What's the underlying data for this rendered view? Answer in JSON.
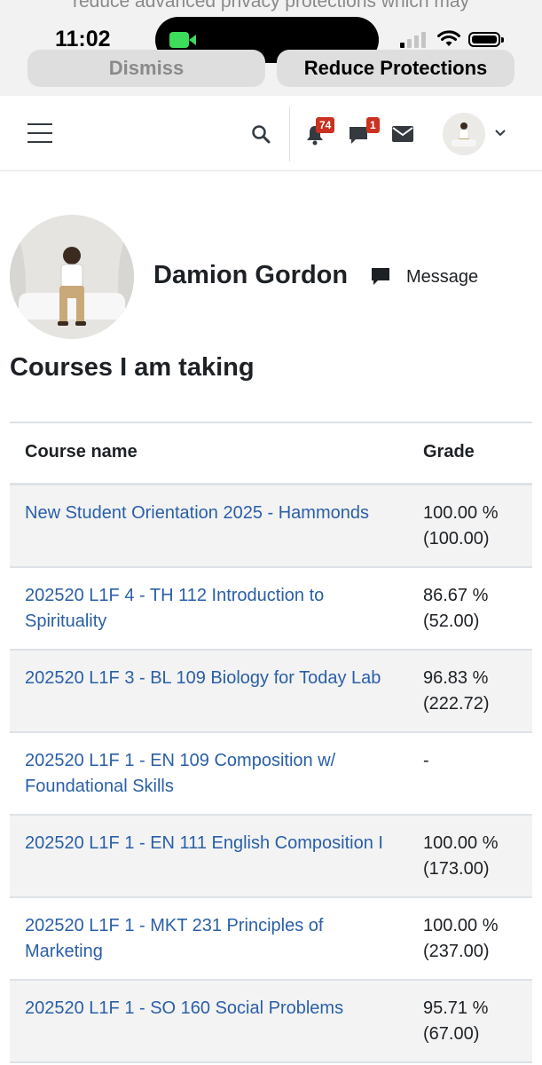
{
  "ios_banner": {
    "message": "reduce advanced privacy protections which may",
    "time": "11:02",
    "dismiss_label": "Dismiss",
    "reduce_label": "Reduce Protections"
  },
  "navbar": {
    "notification_count": "74",
    "message_count": "1",
    "icons": [
      "hamburger-icon",
      "search-icon",
      "bell-icon",
      "chat-icon",
      "mail-icon",
      "chevron-down-icon"
    ]
  },
  "profile": {
    "name": "Damion Gordon",
    "message_label": "Message"
  },
  "courses": {
    "title": "Courses I am taking",
    "columns": [
      "Course name",
      "Grade"
    ],
    "rows": [
      {
        "name": "New Student Orientation 2025 - Hammonds",
        "grade": "100.00 %",
        "points": "(100.00)"
      },
      {
        "name": "202520 L1F 4 - TH 112 Introduction to Spirituality",
        "grade": "86.67 %",
        "points": "(52.00)"
      },
      {
        "name": "202520 L1F 3 - BL 109 Biology for Today Lab",
        "grade": "96.83 %",
        "points": "(222.72)"
      },
      {
        "name": "202520 L1F 1 - EN 109 Composition w/ Foundational Skills",
        "grade": "-",
        "points": ""
      },
      {
        "name": "202520 L1F 1 - EN 111 English Composition I",
        "grade": "100.00 %",
        "points": "(173.00)"
      },
      {
        "name": "202520 L1F 1 - MKT 231 Principles of Marketing",
        "grade": "100.00 %",
        "points": "(237.00)"
      },
      {
        "name": "202520 L1F 1 - SO 160 Social Problems",
        "grade": "95.71 %",
        "points": "(67.00)"
      }
    ]
  },
  "colors": {
    "link": "#2a5fa8",
    "badge": "#ca3120",
    "stripe": "#f3f3f3",
    "border": "#dee2e6"
  }
}
